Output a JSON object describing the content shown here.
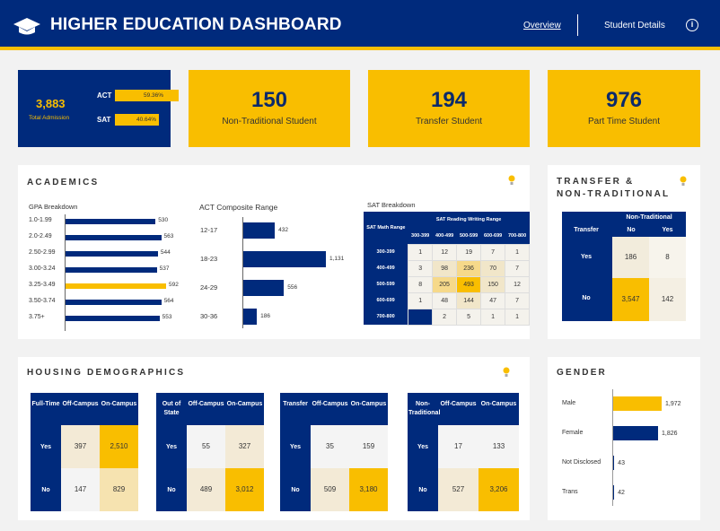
{
  "header": {
    "title": "HIGHER EDUCATION DASHBOARD",
    "nav": [
      "Overview",
      "Student Details"
    ],
    "info_glyph": "i",
    "colors": {
      "navy": "#002a7c",
      "gold": "#f9be00"
    }
  },
  "admission": {
    "value": "3,883",
    "label": "Total Admission",
    "act_label": "ACT",
    "act_pct": "59.36%",
    "act_frac": 0.5936,
    "sat_label": "SAT",
    "sat_pct": "40.64%",
    "sat_frac": 0.4064
  },
  "kpis": [
    {
      "value": "150",
      "label": "Non-Traditional Student"
    },
    {
      "value": "194",
      "label": "Transfer Student"
    },
    {
      "value": "976",
      "label": "Part Time Student"
    }
  ],
  "academics": {
    "title": "ACADEMICS",
    "gpa": {
      "title": "GPA Breakdown",
      "rows": [
        {
          "label": "1.0-1.99",
          "value": 530,
          "display": "530",
          "highlight": false
        },
        {
          "label": "2.0-2.49",
          "value": 563,
          "display": "563",
          "highlight": false
        },
        {
          "label": "2.50-2.99",
          "value": 544,
          "display": "544",
          "highlight": false
        },
        {
          "label": "3.00-3.24",
          "value": 537,
          "display": "537",
          "highlight": false
        },
        {
          "label": "3.25-3.49",
          "value": 592,
          "display": "592",
          "highlight": true
        },
        {
          "label": "3.50-3.74",
          "value": 564,
          "display": "564",
          "highlight": false
        },
        {
          "label": "3.75+",
          "value": 553,
          "display": "553",
          "highlight": false
        }
      ]
    },
    "act": {
      "title": "ACT Composite Range",
      "rows": [
        {
          "label": "12-17",
          "value": 432,
          "display": "432"
        },
        {
          "label": "18-23",
          "value": 1131,
          "display": "1,131"
        },
        {
          "label": "24-29",
          "value": 556,
          "display": "556"
        },
        {
          "label": "30-36",
          "value": 186,
          "display": "186"
        }
      ]
    },
    "sat": {
      "title": "SAT Breakdown",
      "row_header": "SAT Math Range",
      "col_header": "SAT Reading Writing Range",
      "cols": [
        "300-399",
        "400-499",
        "500-599",
        "600-699",
        "700-800"
      ],
      "rows": [
        {
          "label": "300-399",
          "cells": [
            "1",
            "12",
            "19",
            "7",
            "1"
          ]
        },
        {
          "label": "400-499",
          "cells": [
            "3",
            "98",
            "236",
            "70",
            "7"
          ]
        },
        {
          "label": "500-599",
          "cells": [
            "8",
            "205",
            "493",
            "150",
            "12"
          ]
        },
        {
          "label": "600-699",
          "cells": [
            "1",
            "48",
            "144",
            "47",
            "7"
          ]
        },
        {
          "label": "700-800",
          "cells": [
            "",
            "2",
            "5",
            "1",
            "1"
          ]
        }
      ]
    }
  },
  "transfer": {
    "title_line1": "TRANSFER &",
    "title_line2": "NON-TRADITIONAL",
    "row_header": "Transfer",
    "col_header": "Non-Traditional",
    "cols": [
      "No",
      "Yes"
    ],
    "rows": [
      {
        "label": "Yes",
        "cells": [
          "186",
          "8"
        ]
      },
      {
        "label": "No",
        "cells": [
          "3,547",
          "142"
        ]
      }
    ]
  },
  "housing": {
    "title": "HOUSING DEMOGRAPHICS",
    "matrices": [
      {
        "row_header": "Full-Time",
        "cols": [
          "Off-Campus",
          "On-Campus"
        ],
        "rows": [
          {
            "label": "Yes",
            "cells": [
              "397",
              "2,510"
            ]
          },
          {
            "label": "No",
            "cells": [
              "147",
              "829"
            ]
          }
        ]
      },
      {
        "row_header": "Out of State",
        "cols": [
          "Off-Campus",
          "On-Campus"
        ],
        "rows": [
          {
            "label": "Yes",
            "cells": [
              "55",
              "327"
            ]
          },
          {
            "label": "No",
            "cells": [
              "489",
              "3,012"
            ]
          }
        ]
      },
      {
        "row_header": "Transfer",
        "cols": [
          "Off-Campus",
          "On-Campus"
        ],
        "rows": [
          {
            "label": "Yes",
            "cells": [
              "35",
              "159"
            ]
          },
          {
            "label": "No",
            "cells": [
              "509",
              "3,180"
            ]
          }
        ]
      },
      {
        "row_header": "Non-Traditional",
        "cols": [
          "Off-Campus",
          "On-Campus"
        ],
        "rows": [
          {
            "label": "Yes",
            "cells": [
              "17",
              "133"
            ]
          },
          {
            "label": "No",
            "cells": [
              "527",
              "3,206"
            ]
          }
        ]
      }
    ]
  },
  "gender": {
    "title": "GENDER",
    "rows": [
      {
        "label": "Male",
        "value": 1972,
        "display": "1,972"
      },
      {
        "label": "Female",
        "value": 1826,
        "display": "1,826"
      },
      {
        "label": "Not Disclosed",
        "value": 43,
        "display": "43"
      },
      {
        "label": "Trans",
        "value": 42,
        "display": "42"
      }
    ]
  },
  "chart_data": [
    {
      "type": "bar",
      "title": "GPA Breakdown",
      "categories": [
        "1.0-1.99",
        "2.0-2.49",
        "2.50-2.99",
        "3.00-3.24",
        "3.25-3.49",
        "3.50-3.74",
        "3.75+"
      ],
      "values": [
        530,
        563,
        544,
        537,
        592,
        564,
        553
      ]
    },
    {
      "type": "bar",
      "title": "ACT Composite Range",
      "categories": [
        "12-17",
        "18-23",
        "24-29",
        "30-36"
      ],
      "values": [
        432,
        1131,
        556,
        186
      ]
    },
    {
      "type": "heatmap",
      "title": "SAT Breakdown",
      "x": [
        "300-399",
        "400-499",
        "500-599",
        "600-699",
        "700-800"
      ],
      "y": [
        "300-399",
        "400-499",
        "500-599",
        "600-699",
        "700-800"
      ],
      "values": [
        [
          1,
          12,
          19,
          7,
          1
        ],
        [
          3,
          98,
          236,
          70,
          7
        ],
        [
          8,
          205,
          493,
          150,
          12
        ],
        [
          1,
          48,
          144,
          47,
          7
        ],
        [
          null,
          2,
          5,
          1,
          1
        ]
      ]
    },
    {
      "type": "bar",
      "title": "GENDER",
      "categories": [
        "Male",
        "Female",
        "Not Disclosed",
        "Trans"
      ],
      "values": [
        1972,
        1826,
        43,
        42
      ]
    }
  ]
}
